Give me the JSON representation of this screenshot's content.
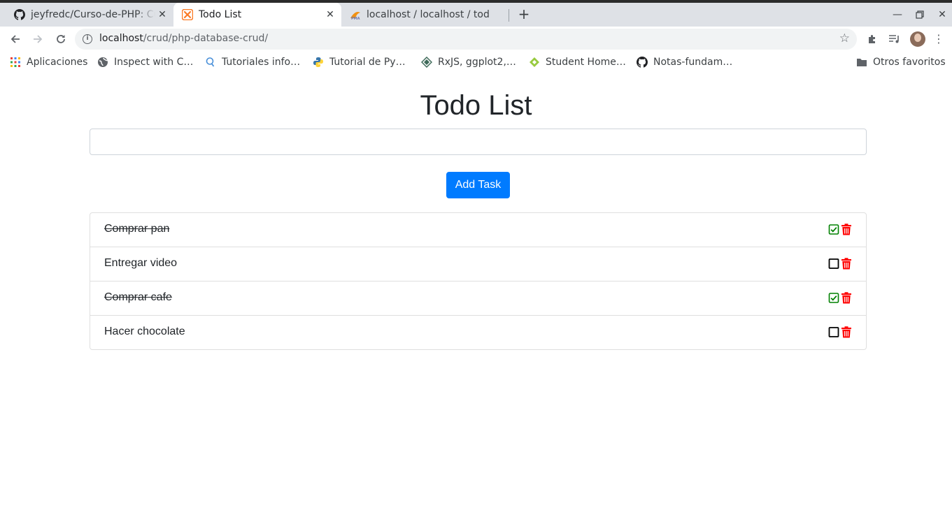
{
  "browser": {
    "tabs": [
      {
        "title": "jeyfredc/Curso-de-PHP: Cu",
        "icon": "github-icon",
        "active": false
      },
      {
        "title": "Todo List",
        "icon": "xampp-icon",
        "active": true
      },
      {
        "title": "localhost / localhost / tod",
        "icon": "phpmyadmin-icon",
        "active": false
      }
    ],
    "url": {
      "host": "localhost",
      "path": "/crud/php-database-crud/"
    },
    "bookmarks": [
      {
        "label": "Aplicaciones",
        "icon": "apps-grid-icon"
      },
      {
        "label": "Inspect with C…",
        "icon": "globe-icon"
      },
      {
        "label": "Tutoriales info…",
        "icon": "search-icon"
      },
      {
        "label": "Tutorial de Py…",
        "icon": "python-icon"
      },
      {
        "label": "RxJS, ggplot2,…",
        "icon": "diamond-icon"
      },
      {
        "label": "Student Home…",
        "icon": "leaf-icon"
      },
      {
        "label": "Notas-fundam…",
        "icon": "github-icon"
      }
    ],
    "other_bookmarks": {
      "label": "Otros favoritos",
      "icon": "folder-icon"
    }
  },
  "page": {
    "title": "Todo List",
    "input": {
      "value": "",
      "placeholder": ""
    },
    "add_button": "Add Task",
    "tasks": [
      {
        "text": "Comprar pan",
        "completed": true
      },
      {
        "text": "Entregar video",
        "completed": false
      },
      {
        "text": "Comprar cafe",
        "completed": true
      },
      {
        "text": "Hacer chocolate",
        "completed": false
      }
    ]
  },
  "colors": {
    "primary": "#007bff",
    "done_check": "#008000",
    "delete": "#ff0000",
    "text": "#212529",
    "border": "#dfdfdf"
  }
}
